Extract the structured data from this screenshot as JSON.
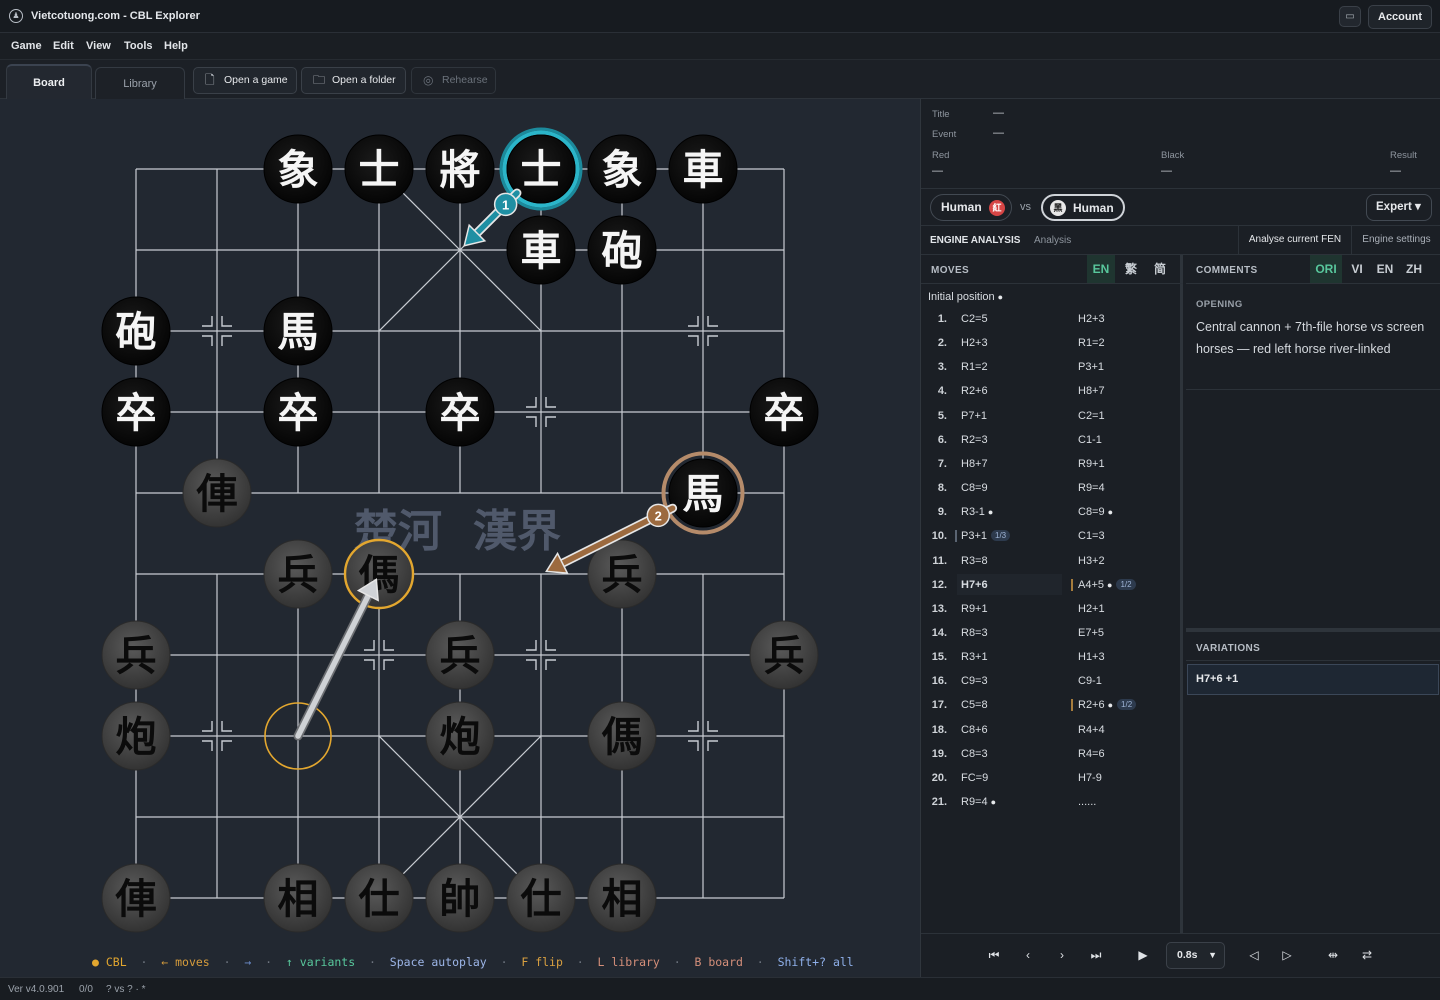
{
  "window": {
    "title": "Vietcotuong.com - CBL Explorer",
    "account_label": "Account"
  },
  "menu": [
    "Game",
    "Edit",
    "View",
    "Tools",
    "Help"
  ],
  "tabs": {
    "board": "Board",
    "library": "Library"
  },
  "toolbar": {
    "open_game": "Open a game",
    "open_folder": "Open a folder",
    "rehearse": "Rehearse"
  },
  "board": {
    "river_left": "楚河",
    "river_right": "漢界",
    "pieces": [
      {
        "char": "象",
        "side": "black",
        "file": 3,
        "rank": 0
      },
      {
        "char": "士",
        "side": "black",
        "file": 4,
        "rank": 0
      },
      {
        "char": "將",
        "side": "black",
        "file": 5,
        "rank": 0
      },
      {
        "char": "士",
        "side": "black",
        "file": 6,
        "rank": 0,
        "state": "selected"
      },
      {
        "char": "象",
        "side": "black",
        "file": 7,
        "rank": 0
      },
      {
        "char": "車",
        "side": "black",
        "file": 8,
        "rank": 0
      },
      {
        "char": "車",
        "side": "black",
        "file": 6,
        "rank": 1
      },
      {
        "char": "砲",
        "side": "black",
        "file": 7,
        "rank": 1
      },
      {
        "char": "砲",
        "side": "black",
        "file": 1,
        "rank": 2
      },
      {
        "char": "馬",
        "side": "black",
        "file": 3,
        "rank": 2
      },
      {
        "char": "卒",
        "side": "black",
        "file": 1,
        "rank": 3
      },
      {
        "char": "卒",
        "side": "black",
        "file": 3,
        "rank": 3
      },
      {
        "char": "卒",
        "side": "black",
        "file": 5,
        "rank": 3
      },
      {
        "char": "卒",
        "side": "black",
        "file": 9,
        "rank": 3
      },
      {
        "char": "馬",
        "side": "black",
        "file": 8,
        "rank": 4,
        "state": "candidate"
      },
      {
        "char": "俥",
        "side": "red",
        "file": 2,
        "rank": 4
      },
      {
        "char": "兵",
        "side": "red",
        "file": 3,
        "rank": 5
      },
      {
        "char": "傌",
        "side": "red",
        "file": 4,
        "rank": 5,
        "state": "last-move"
      },
      {
        "char": "兵",
        "side": "red",
        "file": 7,
        "rank": 5
      },
      {
        "char": "兵",
        "side": "red",
        "file": 1,
        "rank": 6
      },
      {
        "char": "兵",
        "side": "red",
        "file": 5,
        "rank": 6
      },
      {
        "char": "兵",
        "side": "red",
        "file": 9,
        "rank": 6
      },
      {
        "char": "炮",
        "side": "red",
        "file": 1,
        "rank": 7
      },
      {
        "char": "炮",
        "side": "red",
        "file": 5,
        "rank": 7
      },
      {
        "char": "傌",
        "side": "red",
        "file": 7,
        "rank": 7
      },
      {
        "char": "俥",
        "side": "red",
        "file": 1,
        "rank": 9
      },
      {
        "char": "相",
        "side": "red",
        "file": 3,
        "rank": 9
      },
      {
        "char": "仕",
        "side": "red",
        "file": 4,
        "rank": 9
      },
      {
        "char": "帥",
        "side": "red",
        "file": 5,
        "rank": 9
      },
      {
        "char": "仕",
        "side": "red",
        "file": 6,
        "rank": 9
      },
      {
        "char": "相",
        "side": "red",
        "file": 7,
        "rank": 9
      }
    ],
    "arrows": [
      {
        "label": "1",
        "color": "#1f8fa3",
        "from": [
          6,
          0
        ],
        "to": [
          5,
          1
        ]
      },
      {
        "label": "2",
        "color": "#9c6a3f",
        "from": [
          8,
          4
        ],
        "to": [
          6,
          5
        ]
      },
      {
        "label": "",
        "color": "#cfd2d6",
        "from": [
          3,
          7
        ],
        "to": [
          4,
          5
        ]
      }
    ],
    "origin_marker": {
      "file": 3,
      "rank": 7
    }
  },
  "hints": [
    {
      "text": "●",
      "color": "#e3a72f"
    },
    {
      "text": " CBL",
      "color": "#e3a72f"
    },
    {
      "text": "  ·  ",
      "color": "#6f7680"
    },
    {
      "text": "← moves",
      "color": "#d69c3c"
    },
    {
      "text": "  ·  ",
      "color": "#6f7680"
    },
    {
      "text": "→",
      "color": "#6f8fd0"
    },
    {
      "text": "  ·  ",
      "color": "#6f7680"
    },
    {
      "text": "↑ variants",
      "color": "#58c79c"
    },
    {
      "text": "  ·  ",
      "color": "#6f7680"
    },
    {
      "text": "Space autoplay",
      "color": "#9db6e8"
    },
    {
      "text": "  ·  ",
      "color": "#6f7680"
    },
    {
      "text": "F flip",
      "color": "#d9a040"
    },
    {
      "text": "  ·  ",
      "color": "#6f7680"
    },
    {
      "text": "L library",
      "color": "#d58f7a"
    },
    {
      "text": "  ·  ",
      "color": "#6f7680"
    },
    {
      "text": "B board",
      "color": "#d58f7a"
    },
    {
      "text": "  ·  ",
      "color": "#6f7680"
    },
    {
      "text": "Shift+? all",
      "color": "#8fb0ea"
    }
  ],
  "status": {
    "version": "Ver v4.0.901",
    "count": "0/0",
    "result": "? vs ? · *"
  },
  "game_info": {
    "title_label": "Title",
    "title_value": "—",
    "event_label": "Event",
    "event_value": "—",
    "red_label": "Red",
    "red_value": "—",
    "black_label": "Black",
    "black_value": "—",
    "result_label": "Result",
    "result_value": "—"
  },
  "players": {
    "red": "Human",
    "red_badge": "紅",
    "vs": "vs",
    "black": "Human",
    "black_badge": "黑",
    "level": "Expert ▾"
  },
  "engine": {
    "title": "ENGINE ANALYSIS",
    "subtitle": "Analysis",
    "analyse": "Analyse current FEN",
    "settings": "Engine settings"
  },
  "moves": {
    "title": "MOVES",
    "langs": [
      "EN",
      "繁",
      "简"
    ],
    "initial": "Initial position",
    "rows": [
      {
        "n": "1.",
        "r": "C2=5",
        "b": "H2+3"
      },
      {
        "n": "2.",
        "r": "H2+3",
        "b": "R1=2"
      },
      {
        "n": "3.",
        "r": "R1=2",
        "b": "P3+1"
      },
      {
        "n": "4.",
        "r": "R2+6",
        "b": "H8+7"
      },
      {
        "n": "5.",
        "r": "P7+1",
        "b": "C2=1"
      },
      {
        "n": "6.",
        "r": "R2=3",
        "b": "C1-1"
      },
      {
        "n": "7.",
        "r": "H8+7",
        "b": "R9+1"
      },
      {
        "n": "8.",
        "r": "C8=9",
        "b": "R9=4"
      },
      {
        "n": "9.",
        "r": "R3-1",
        "b": "C8=9",
        "rc": true,
        "bc": true
      },
      {
        "n": "10.",
        "r": "P3+1",
        "b": "C1=3",
        "rbadge": "1/3"
      },
      {
        "n": "11.",
        "r": "R3=8",
        "b": "H3+2"
      },
      {
        "n": "12.",
        "r": "H7+6",
        "b": "A4+5",
        "bc": true,
        "bbadge": "1/2",
        "current": true
      },
      {
        "n": "13.",
        "r": "R9+1",
        "b": "H2+1"
      },
      {
        "n": "14.",
        "r": "R8=3",
        "b": "E7+5"
      },
      {
        "n": "15.",
        "r": "R3+1",
        "b": "H1+3"
      },
      {
        "n": "16.",
        "r": "C9=3",
        "b": "C9-1"
      },
      {
        "n": "17.",
        "r": "C5=8",
        "b": "R2+6",
        "bc": true,
        "bbadge": "1/2"
      },
      {
        "n": "18.",
        "r": "C8+6",
        "b": "R4+4"
      },
      {
        "n": "19.",
        "r": "C8=3",
        "b": "R4=6"
      },
      {
        "n": "20.",
        "r": "FC=9",
        "b": "H7-9"
      },
      {
        "n": "21.",
        "r": "R9=4",
        "b": "......",
        "rc": true
      }
    ]
  },
  "comments": {
    "title": "COMMENTS",
    "langs": [
      "ORI",
      "VI",
      "EN",
      "ZH"
    ],
    "section": "OPENING",
    "text": "Central cannon + 7th-file horse vs screen horses — red left horse river-linked"
  },
  "variations": {
    "title": "VARIATIONS",
    "items": [
      "H7+6 +1"
    ]
  },
  "playback": {
    "speed": "0.8s"
  }
}
